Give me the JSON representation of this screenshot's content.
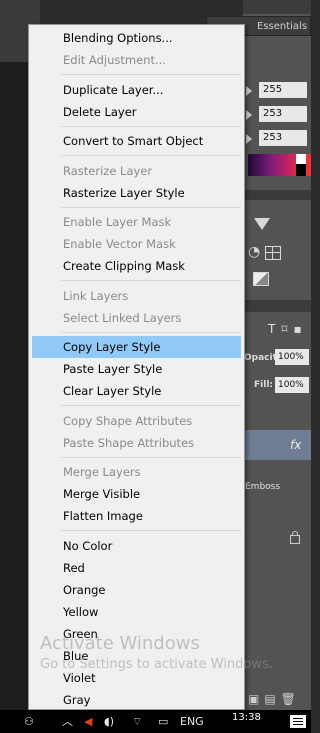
{
  "workspace": {
    "essentials_label": "Essentials",
    "color_values": [
      "255",
      "253",
      "253"
    ],
    "opacity_label": "Opacity:",
    "opacity_value": "100%",
    "fill_label": "Fill:",
    "fill_value": "100%",
    "layer_effect_label": "Emboss",
    "fx_label": "fx"
  },
  "context_menu": {
    "items": [
      {
        "label": "Blending Options...",
        "enabled": true
      },
      {
        "label": "Edit Adjustment...",
        "enabled": false
      },
      {
        "label": "Duplicate Layer...",
        "enabled": true
      },
      {
        "label": "Delete Layer",
        "enabled": true
      },
      {
        "label": "Convert to Smart Object",
        "enabled": true
      },
      {
        "label": "Rasterize Layer",
        "enabled": false
      },
      {
        "label": "Rasterize Layer Style",
        "enabled": true
      },
      {
        "label": "Enable Layer Mask",
        "enabled": false
      },
      {
        "label": "Enable Vector Mask",
        "enabled": false
      },
      {
        "label": "Create Clipping Mask",
        "enabled": true
      },
      {
        "label": "Link Layers",
        "enabled": false
      },
      {
        "label": "Select Linked Layers",
        "enabled": false
      },
      {
        "label": "Copy Layer Style",
        "enabled": true,
        "highlighted": true
      },
      {
        "label": "Paste Layer Style",
        "enabled": true
      },
      {
        "label": "Clear Layer Style",
        "enabled": true
      },
      {
        "label": "Copy Shape Attributes",
        "enabled": false
      },
      {
        "label": "Paste Shape Attributes",
        "enabled": false
      },
      {
        "label": "Merge Layers",
        "enabled": false
      },
      {
        "label": "Merge Visible",
        "enabled": true
      },
      {
        "label": "Flatten Image",
        "enabled": true
      },
      {
        "label": "No Color",
        "enabled": true
      },
      {
        "label": "Red",
        "enabled": true
      },
      {
        "label": "Orange",
        "enabled": true
      },
      {
        "label": "Yellow",
        "enabled": true
      },
      {
        "label": "Green",
        "enabled": true
      },
      {
        "label": "Blue",
        "enabled": true
      },
      {
        "label": "Violet",
        "enabled": true
      },
      {
        "label": "Gray",
        "enabled": true
      }
    ]
  },
  "watermark": {
    "title": "Activate Windows",
    "subtitle": "Go to Settings to activate Windows."
  },
  "taskbar": {
    "language": "ENG",
    "time": "13:38"
  },
  "colors": {
    "menu_bg": "#f0f0f0",
    "highlight": "#91c9f7",
    "disabled_text": "#8a8a8a"
  }
}
